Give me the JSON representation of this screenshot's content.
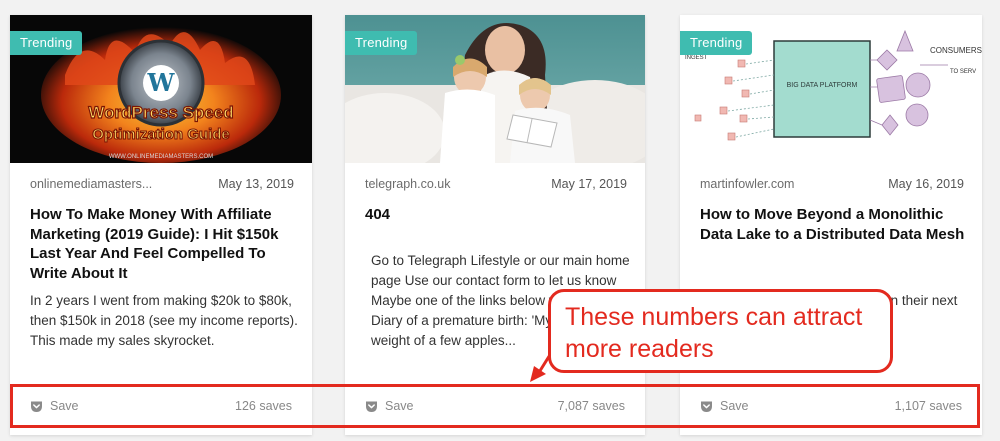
{
  "cards": [
    {
      "badge": "Trending",
      "image_text": {
        "line1": "WordPress Speed",
        "line2": "Optimization Guide",
        "url": "WWW.ONLINEMEDIAMASTERS.COM"
      },
      "source": "onlinemediamasters...",
      "date": "May 13, 2019",
      "title": "How To Make Money With Affiliate Marketing (2019 Guide): I Hit $150k Last Year And Feel Compelled To Write About It",
      "excerpt": "In 2 years I went from making $20k to $80k, then $150k in 2018 (see my income reports). This made my sales skyrocket.",
      "save_label": "Save",
      "saves": "126 saves"
    },
    {
      "badge": "Trending",
      "source": "telegraph.co.uk",
      "date": "May 17, 2019",
      "title": "404",
      "excerpt": "Go to Telegraph Lifestyle or our main home page Use our contact form to let us know Maybe one of the links below will help? Diary of a premature birth: 'My tw... the weight of a few apples...",
      "save_label": "Save",
      "saves": "7,087 saves"
    },
    {
      "badge": "Trending",
      "image_text": {
        "consumers": "CONSUMERS",
        "to_serve": "TO SERV",
        "ingest": "INGEST",
        "platform": "BIG DATA PLATFORM"
      },
      "source": "martinfowler.com",
      "date": "May 16, 2019",
      "title": "How to Move Beyond a Monolithic Data Lake to a Distributed Data Mesh",
      "excerpt": "Many enterprises are investing in their next ...ne of ...vide ...ake",
      "save_label": "Save",
      "saves": "1,107 saves"
    }
  ],
  "annotation": {
    "callout_line1": "These numbers can attract",
    "callout_line2": "more readers",
    "color": "#e32a1f"
  },
  "colors": {
    "badge": "#3fbcb0",
    "background": "#f2f2f2"
  }
}
